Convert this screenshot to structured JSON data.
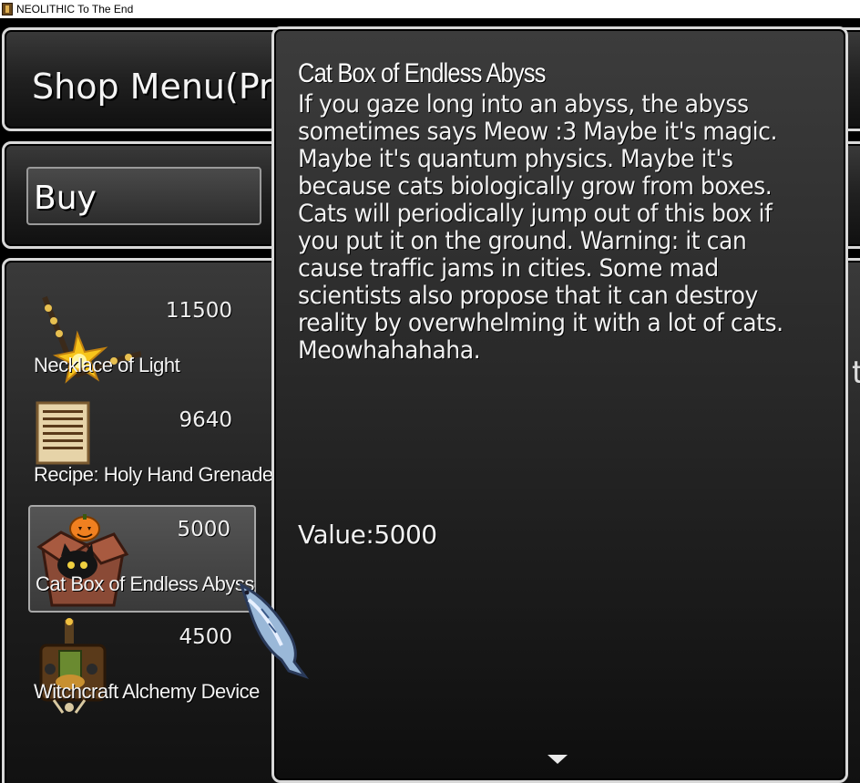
{
  "window": {
    "title": "NEOLITHIC To The End",
    "icon": "game-app-icon"
  },
  "shop": {
    "title": "Shop Menu(Pre",
    "buy_label": "Buy",
    "right_glyph": "t",
    "items": [
      {
        "name": "Necklace of Light",
        "price": "11500",
        "icon": "necklace-icon",
        "selected": false
      },
      {
        "name": "Recipe: Holy Hand Grenade",
        "price": "9640",
        "icon": "recipe-scroll-icon",
        "selected": false
      },
      {
        "name": "Cat Box of Endless Abyss",
        "price": "5000",
        "icon": "cat-box-icon",
        "selected": true
      },
      {
        "name": "Witchcraft Alchemy Device",
        "price": "4500",
        "icon": "alchemy-device-icon",
        "selected": false
      }
    ]
  },
  "help": {
    "title": "Cat Box of Endless Abyss",
    "description": "If you gaze long into an abyss, the abyss sometimes says Meow :3 Maybe it's magic. Maybe it's quantum physics. Maybe it's because cats biologically grow from boxes. Cats will periodically jump out of this box if you put it on the ground. Warning: it can cause traffic jams in cities. Some mad scientists also propose that it can destroy reality by overwhelming it with a lot of cats. Meowhahahaha.",
    "value": "Value:5000",
    "more_icon": "down-arrow-icon"
  },
  "cursor": {
    "icon": "fish-cursor-icon"
  }
}
